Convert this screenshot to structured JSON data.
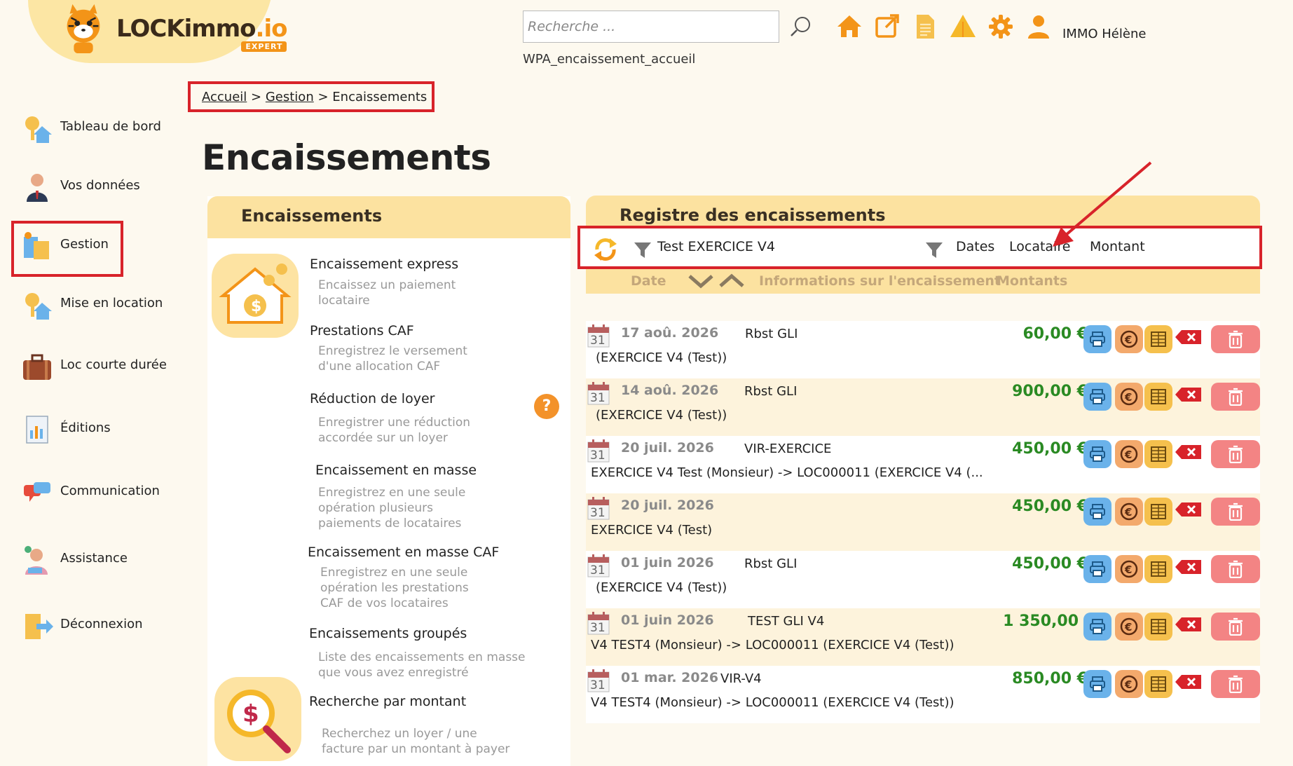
{
  "brand": {
    "name_main": "LOCKimmo",
    "name_suffix": ".io",
    "badge": "EXPERT"
  },
  "header": {
    "search_placeholder": "Recherche ...",
    "user_name": "IMMO Hélène",
    "page_code": "WPA_encaissement_accueil",
    "icons": [
      "home-icon",
      "external-link-icon",
      "document-icon",
      "alert-triangle-icon",
      "gear-icon",
      "user-icon"
    ]
  },
  "sidebar": {
    "items": [
      {
        "label": "Tableau de bord",
        "icon": "dashboard-keys-icon"
      },
      {
        "label": "Vos données",
        "icon": "person-icon"
      },
      {
        "label": "Gestion",
        "icon": "management-icon"
      },
      {
        "label": "Mise en location",
        "icon": "rental-keys-icon"
      },
      {
        "label": "Loc courte durée",
        "icon": "suitcase-icon"
      },
      {
        "label": "Éditions",
        "icon": "editions-icon"
      },
      {
        "label": "Communication",
        "icon": "chat-bubbles-icon"
      },
      {
        "label": "Assistance",
        "icon": "support-agent-icon"
      },
      {
        "label": "Déconnexion",
        "icon": "logout-icon"
      }
    ]
  },
  "breadcrumb": {
    "home": "Accueil",
    "sep1": ">",
    "section": "Gestion",
    "sep2": ">",
    "current": "Encaissements"
  },
  "page_title": "Encaissements",
  "left_panel": {
    "title": "Encaissements",
    "actions": [
      {
        "title": "Encaissement express",
        "desc1": "Encaissez un paiement",
        "desc2": "locataire"
      },
      {
        "title": "Prestations CAF",
        "desc1": "Enregistrez le versement",
        "desc2": "d'une allocation CAF"
      },
      {
        "title": "Réduction de loyer",
        "desc1": "Enregistrer une réduction",
        "desc2": "accordée sur un loyer"
      },
      {
        "title": "Encaissement en masse",
        "desc1": "Enregistrez en une seule",
        "desc2": "opération plusieurs",
        "desc3": "paiements de locataires"
      },
      {
        "title": "Encaissement en masse CAF",
        "desc1": "Enregistrez en une seule",
        "desc2": "opération les prestations",
        "desc3": "CAF de vos locataires"
      },
      {
        "title": "Encaissements groupés",
        "desc1": "Liste des encaissements en masse",
        "desc2": "que vous avez enregistré"
      },
      {
        "title": "Recherche par montant",
        "desc1": "Recherchez un loyer / une",
        "desc2": "facture par un montant à payer"
      }
    ],
    "help": "?"
  },
  "right_panel": {
    "title": "Registre des encaissements",
    "filter": {
      "active_filter": "Test EXERCICE V4",
      "sort_dates": "Dates",
      "sort_locataire": "Locataire",
      "sort_montant": "Montant"
    },
    "columns": {
      "date": "Date",
      "info": "Informations sur l'encaissement",
      "amounts": "Montants"
    },
    "rows": [
      {
        "day": "31",
        "date": "17 aoû. 2026",
        "label": "Rbst GLI",
        "info": "(EXERCICE V4 (Test))",
        "amount": "60,00 €"
      },
      {
        "day": "31",
        "date": "14 aoû. 2026",
        "label": "Rbst GLI",
        "info": "(EXERCICE V4 (Test))",
        "amount": "900,00 €"
      },
      {
        "day": "31",
        "date": "20 juil. 2026",
        "label": "VIR-EXERCICE",
        "info": "EXERCICE V4 Test (Monsieur) -> LOC000011 (EXERCICE V4 (...",
        "amount": "450,00 €"
      },
      {
        "day": "31",
        "date": "20 juil. 2026",
        "label": "",
        "info": "EXERCICE V4 (Test)",
        "amount": "450,00 €"
      },
      {
        "day": "31",
        "date": "01 juin 2026",
        "label": "Rbst GLI",
        "info": "(EXERCICE V4 (Test))",
        "amount": "450,00 €"
      },
      {
        "day": "31",
        "date": "01 juin 2026",
        "label": "TEST GLI V4",
        "info": "V4 TEST4 (Monsieur) -> LOC000011 (EXERCICE V4 (Test))",
        "amount": "1 350,00 €"
      },
      {
        "day": "31",
        "date": "01 mar. 2026",
        "label": "VIR-V4",
        "info": "V4 TEST4 (Monsieur) -> LOC000011 (EXERCICE V4 (Test))",
        "amount": "850,00 €"
      }
    ]
  },
  "colors": {
    "accent": "#f39418",
    "highlight_frame": "#d8232a",
    "amount_green": "#2a8a23",
    "panel_header": "#fce2a0",
    "background": "#fdf9ef"
  }
}
